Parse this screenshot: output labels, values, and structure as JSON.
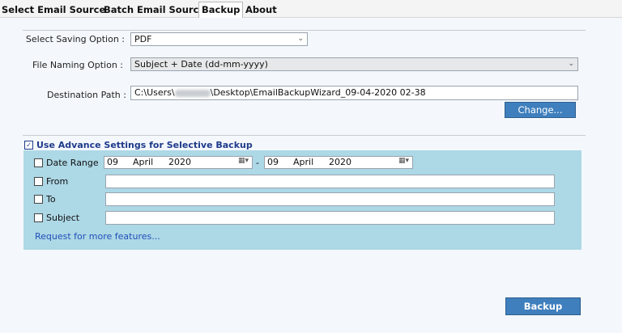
{
  "tabs": [
    {
      "label": "Select Email Source"
    },
    {
      "label": "Batch Email Source"
    },
    {
      "label": "Backup"
    },
    {
      "label": "About"
    }
  ],
  "active_tab": "Backup",
  "saving_option": {
    "label": "Select Saving Option :",
    "value": "PDF"
  },
  "file_naming": {
    "label": "File Naming Option :",
    "value": "Subject + Date (dd-mm-yyyy)"
  },
  "destination": {
    "label": "Destination Path :",
    "value_prefix": "C:\\Users\\",
    "value_suffix": "\\Desktop\\EmailBackupWizard_09-04-2020 02-38"
  },
  "change_button": "Change...",
  "advance": {
    "label": "Use Advance Settings for Selective Backup",
    "checked": true
  },
  "filters": {
    "date_range": {
      "label": "Date Range",
      "from": {
        "day": "09",
        "month": "April",
        "year": "2020"
      },
      "separator": "-",
      "to": {
        "day": "09",
        "month": "April",
        "year": "2020"
      }
    },
    "from": {
      "label": "From",
      "value": ""
    },
    "to": {
      "label": "To",
      "value": ""
    },
    "subject": {
      "label": "Subject",
      "value": ""
    }
  },
  "more_features_link": "Request for more features...",
  "backup_button": "Backup"
}
